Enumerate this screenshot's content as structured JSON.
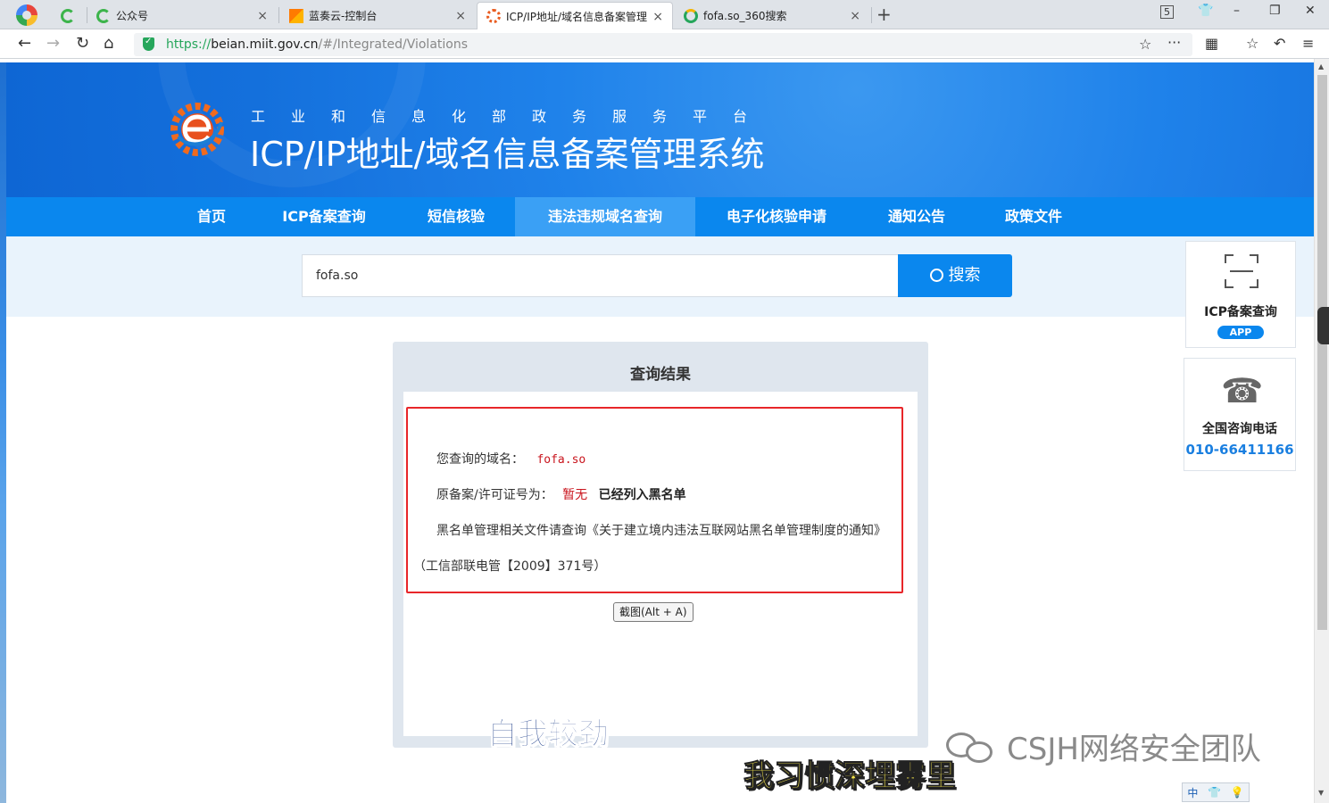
{
  "browser": {
    "tabs": [
      {
        "label": "",
        "icon": "360-green-icon"
      },
      {
        "label": "公众号",
        "icon": "360-green-icon"
      },
      {
        "label": "蓝奏云-控制台",
        "icon": "lanzou-icon"
      },
      {
        "label": "ICP/IP地址/域名信息备案管理",
        "icon": "miit-gear-icon",
        "active": true
      },
      {
        "label": "fofa.so_360搜索",
        "icon": "360search-icon"
      }
    ],
    "close_glyph": "×",
    "new_tab_glyph": "+",
    "tab_count_badge": "5",
    "url_protocol": "https://",
    "url_host": "beian.miit.gov.cn",
    "url_path": "/#/Integrated/Violations"
  },
  "site": {
    "subtitle": "工业和信息化部政务服务平台",
    "title": "ICP/IP地址/域名信息备案管理系统",
    "nav": [
      {
        "label": "首页"
      },
      {
        "label": "ICP备案查询"
      },
      {
        "label": "短信核验"
      },
      {
        "label": "违法违规域名查询",
        "active": true
      },
      {
        "label": "电子化核验申请"
      },
      {
        "label": "通知公告"
      },
      {
        "label": "政策文件"
      }
    ],
    "brand_color": "#0a87ee"
  },
  "search": {
    "value": "fofa.so",
    "button_label": "搜索"
  },
  "result": {
    "title": "查询结果",
    "domain_label": "您查询的域名：",
    "domain_value": "fofa.so",
    "license_label": "原备案/许可证号为：",
    "license_value": "暂无",
    "blacklist_status": "已经列入黑名单",
    "policy_text": "黑名单管理相关文件请查询《关于建立境内违法互联网站黑名单管理制度的通知》",
    "policy_ref": "（工信部联电管【2009】371号）",
    "screenshot_button": "截图(Alt + A)"
  },
  "side": {
    "app_card_title": "ICP备案查询",
    "app_badge": "APP",
    "phone_card_title": "全国咨询电话",
    "phone_number": "010-66411166"
  },
  "overlay": {
    "caption_top": "自我较劲",
    "caption_bottom": "我习惯深埋雾里",
    "watermark": "CSJH网络安全团队",
    "ime_label": "中"
  }
}
